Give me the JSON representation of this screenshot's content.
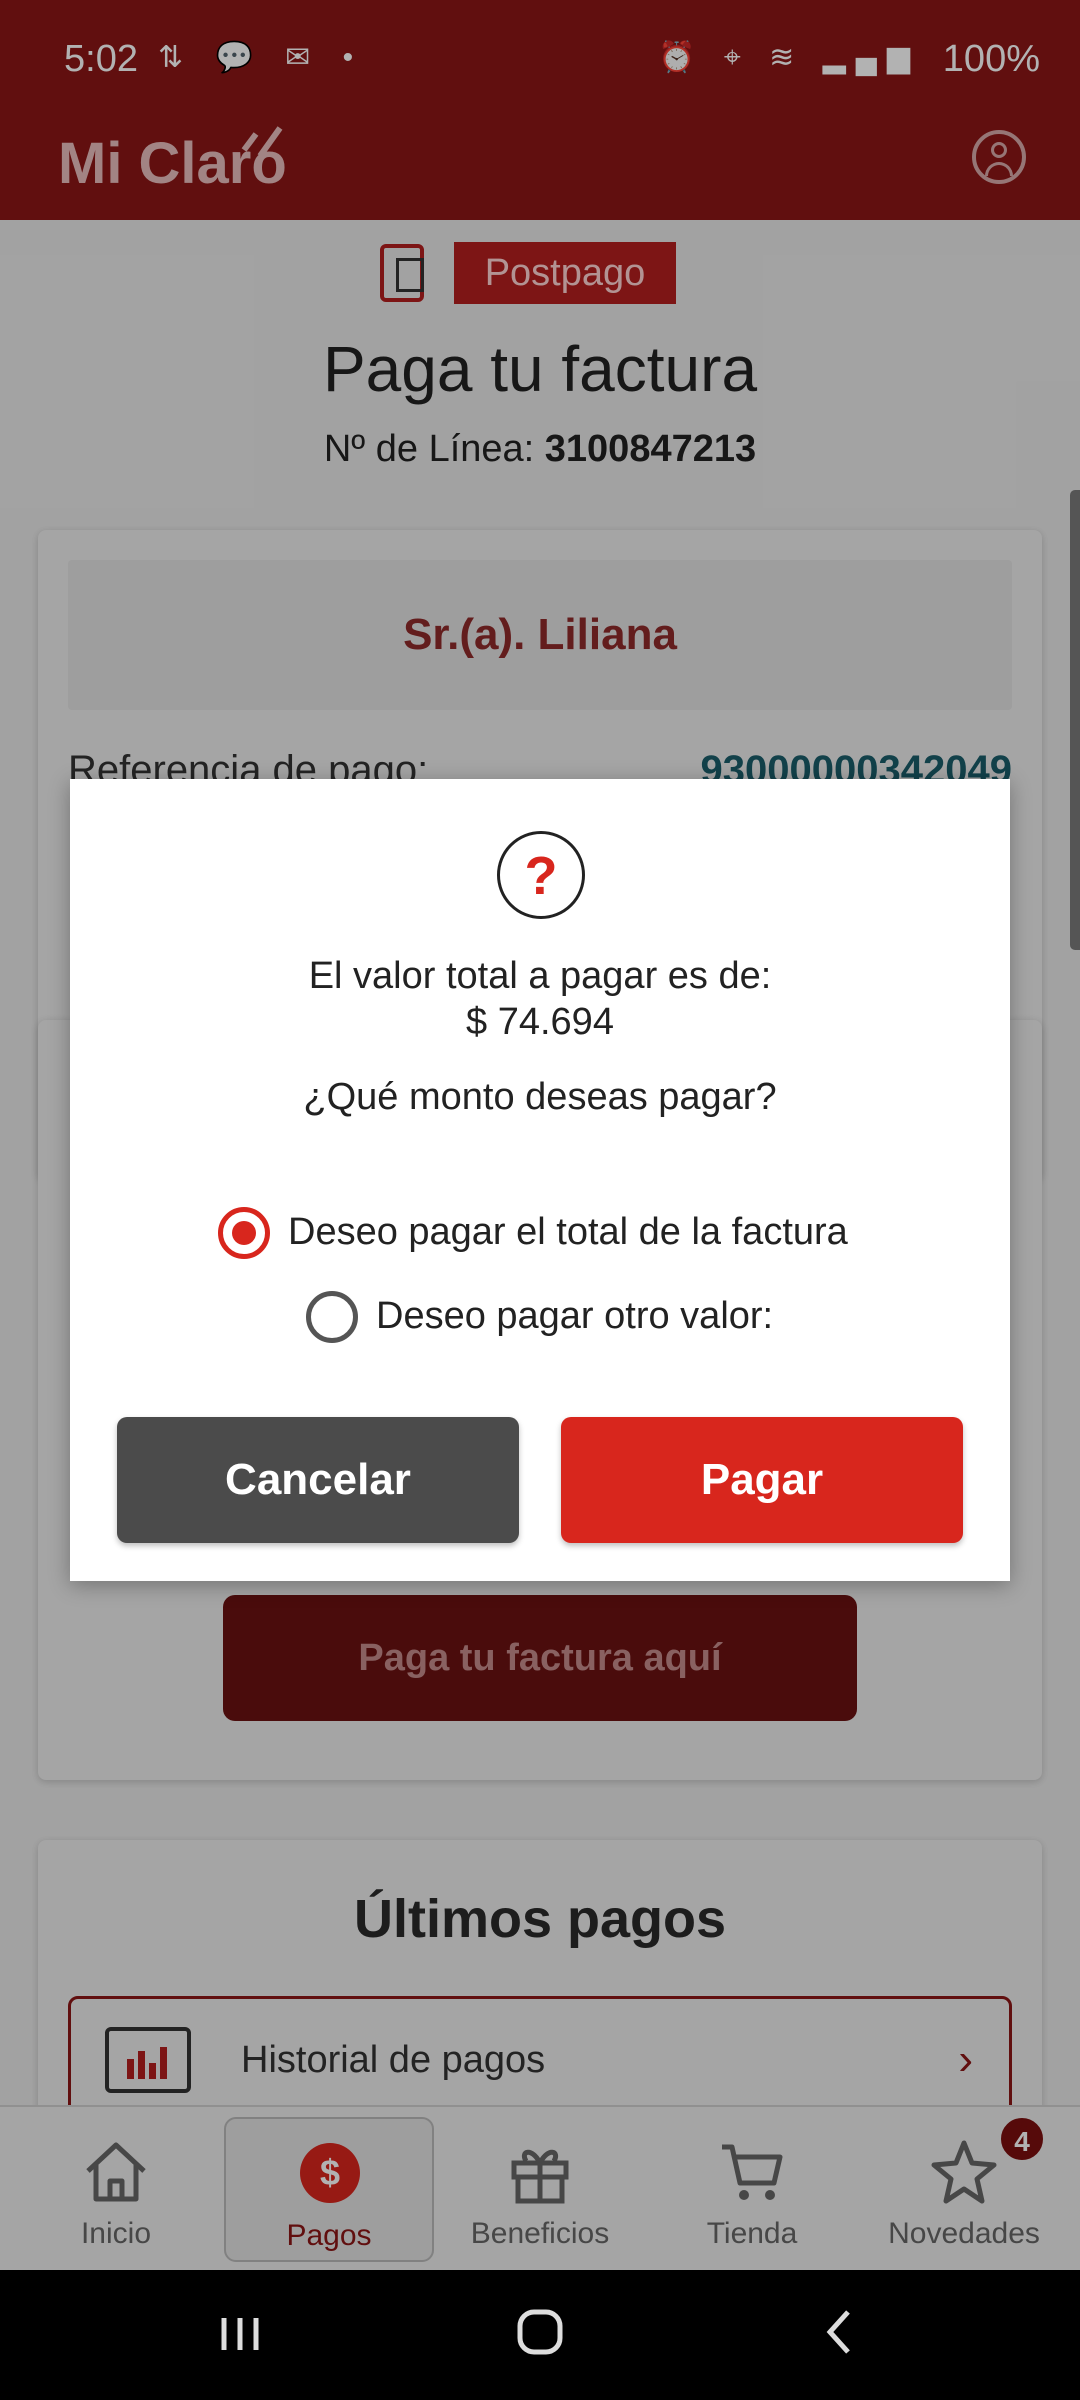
{
  "status_bar": {
    "time": "5:02",
    "left_icons": "⇅ 💬 ✉ •",
    "right_icons": "⏰ ⌖ ≋ ▂▄▆",
    "battery": "100%"
  },
  "app_bar": {
    "logo_text": "Mi Claro",
    "profile_icon": "user-circle-icon"
  },
  "header": {
    "plan_badge": "Postpago",
    "title": "Paga tu factura",
    "line_label": "Nº de Línea:",
    "line_number": "3100847213"
  },
  "account_card": {
    "greeting": "Sr.(a). Liliana",
    "reference_label": "Referencia de pago:",
    "reference_value": "93000000342049"
  },
  "pay_card": {
    "pay_here_button": "Paga tu factura aquí"
  },
  "last_payments": {
    "title": "Últimos pagos",
    "history_label": "Historial de pagos"
  },
  "bottom_nav": {
    "items": [
      {
        "label": "Inicio",
        "icon": "home-icon"
      },
      {
        "label": "Pagos",
        "icon": "dollar-icon",
        "active": true
      },
      {
        "label": "Beneficios",
        "icon": "gift-icon"
      },
      {
        "label": "Tienda",
        "icon": "cart-icon"
      },
      {
        "label": "Novedades",
        "icon": "star-icon",
        "badge": "4"
      }
    ]
  },
  "dialog": {
    "icon": "question-icon",
    "icon_glyph": "?",
    "total_label": "El valor total a pagar es de:",
    "total_value": "$ 74.694",
    "question": "¿Qué monto deseas pagar?",
    "options": [
      {
        "label": "Deseo pagar el total de la factura",
        "selected": true
      },
      {
        "label": "Deseo pagar otro valor:",
        "selected": false
      }
    ],
    "cancel_button": "Cancelar",
    "pay_button": "Pagar"
  },
  "colors": {
    "brand_dark_red": "#8b1616",
    "accent_red": "#d8261d",
    "cancel_gray": "#4b4b4b"
  }
}
